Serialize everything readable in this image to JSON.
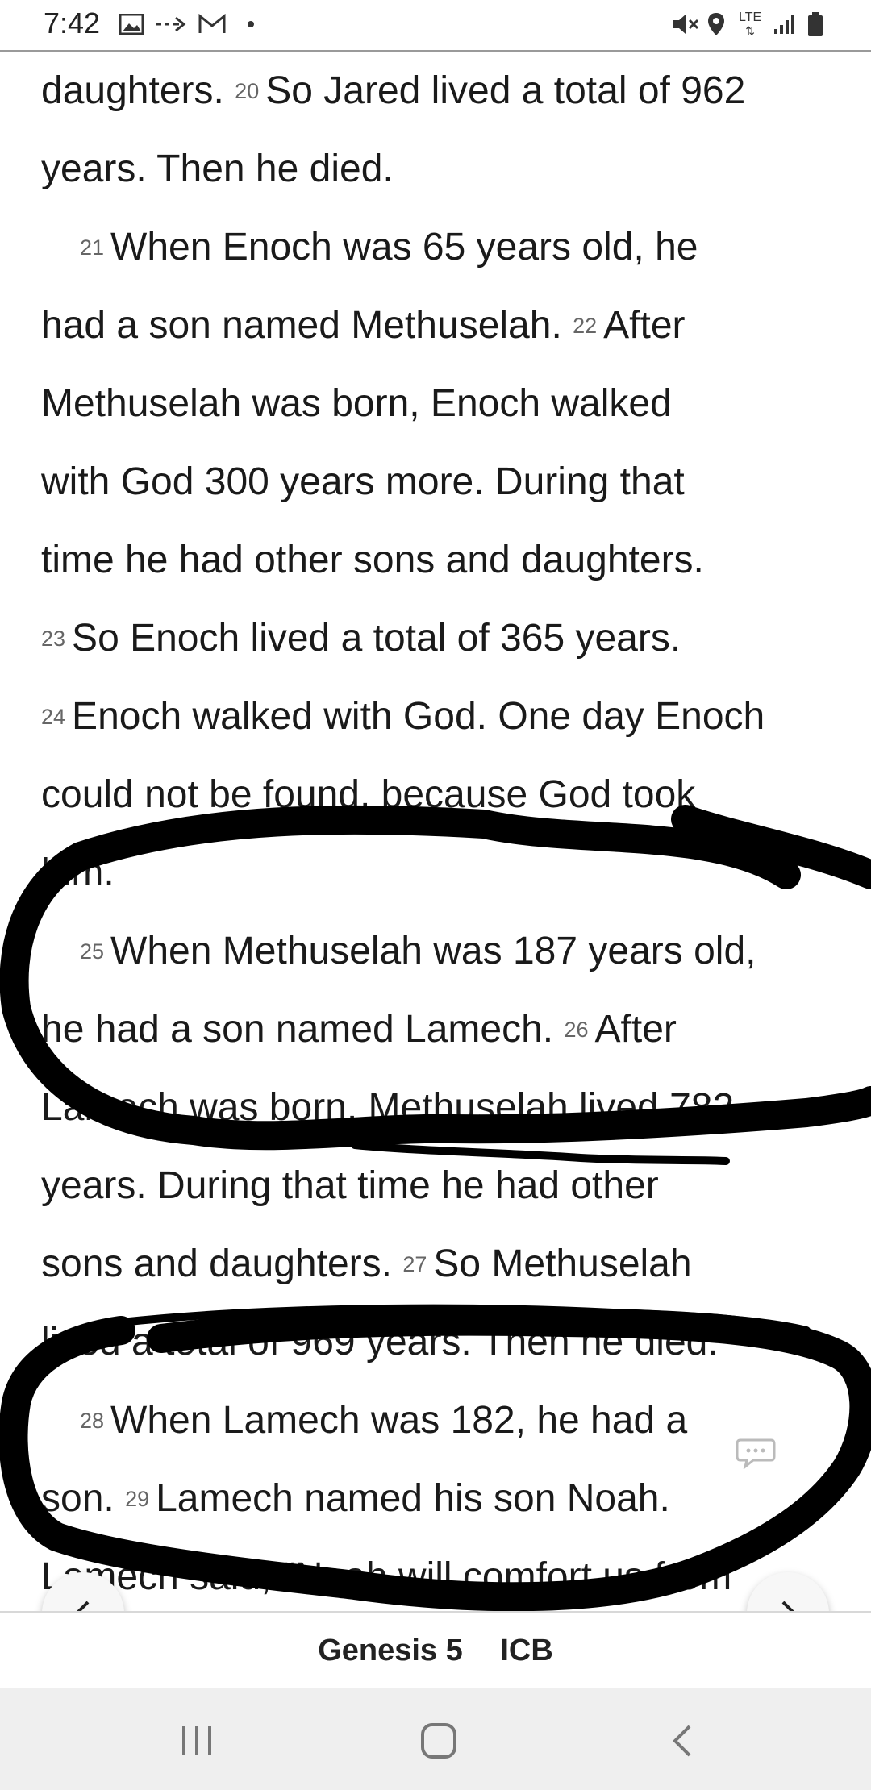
{
  "status_bar": {
    "time": "7:42",
    "left_icons": [
      "image-icon",
      "forward-arrow-icon",
      "gmail-icon",
      "dot-icon"
    ],
    "right_icons": [
      "mute-icon",
      "location-icon",
      "lte-icon",
      "signal-icon",
      "battery-icon"
    ],
    "lte_label": "LTE"
  },
  "reader": {
    "lines": [
      {
        "segments": [
          {
            "t": "text",
            "v": "daughters. "
          },
          {
            "t": "num",
            "v": "20"
          },
          {
            "t": "text",
            "v": "So Jared lived a total of 962"
          }
        ]
      },
      {
        "segments": [
          {
            "t": "text",
            "v": "years. Then he died."
          }
        ]
      },
      {
        "indent": true,
        "segments": [
          {
            "t": "num",
            "v": "21"
          },
          {
            "t": "text",
            "v": "When Enoch was 65 years old, he"
          }
        ]
      },
      {
        "segments": [
          {
            "t": "text",
            "v": "had a son named Methuselah. "
          },
          {
            "t": "num",
            "v": "22"
          },
          {
            "t": "text",
            "v": "After"
          }
        ]
      },
      {
        "segments": [
          {
            "t": "text",
            "v": "Methuselah was born, Enoch walked"
          }
        ]
      },
      {
        "segments": [
          {
            "t": "text",
            "v": "with God 300 years more. During that"
          }
        ]
      },
      {
        "segments": [
          {
            "t": "text",
            "v": "time he had other sons and daughters."
          }
        ]
      },
      {
        "segments": [
          {
            "t": "num",
            "v": "23"
          },
          {
            "t": "text",
            "v": "So Enoch lived a total of 365 years."
          }
        ]
      },
      {
        "segments": [
          {
            "t": "num",
            "v": "24"
          },
          {
            "t": "text",
            "v": "Enoch walked with God. One day Enoch"
          }
        ]
      },
      {
        "segments": [
          {
            "t": "text",
            "v": "could not be found, because God took"
          }
        ]
      },
      {
        "segments": [
          {
            "t": "text",
            "v": "him."
          }
        ]
      },
      {
        "indent": true,
        "segments": [
          {
            "t": "num",
            "v": "25"
          },
          {
            "t": "text",
            "v": "When Methuselah was 187 years old,"
          }
        ]
      },
      {
        "segments": [
          {
            "t": "text",
            "v": "he had a son named Lamech. "
          },
          {
            "t": "num",
            "v": "26"
          },
          {
            "t": "text",
            "v": "After"
          }
        ]
      },
      {
        "segments": [
          {
            "t": "text",
            "v": "Lamech was born, Methuselah lived 782"
          }
        ]
      },
      {
        "segments": [
          {
            "t": "text",
            "v": "years. During that time he had other"
          }
        ]
      },
      {
        "segments": [
          {
            "t": "text",
            "v": "sons and daughters. "
          },
          {
            "t": "num",
            "v": "27"
          },
          {
            "t": "text",
            "v": "So Methuselah"
          }
        ]
      },
      {
        "segments": [
          {
            "t": "text",
            "v": "lived a total of 969 years. Then he died."
          }
        ]
      },
      {
        "indent": true,
        "segments": [
          {
            "t": "num",
            "v": "28"
          },
          {
            "t": "text",
            "v": "When Lamech was 182, he had a"
          }
        ]
      },
      {
        "segments": [
          {
            "t": "text",
            "v": "son. "
          },
          {
            "t": "num",
            "v": "29"
          },
          {
            "t": "text",
            "v": "Lamech named his son Noah."
          }
        ]
      },
      {
        "segments": [
          {
            "t": "text",
            "v": "Lamech said, “Noah will comfort us from"
          }
        ]
      }
    ],
    "annotation_color": "#000000"
  },
  "navigation": {
    "prev_icon": "chevron-left-icon",
    "next_icon": "chevron-right-icon",
    "book_chapter": "Genesis 5",
    "version": "ICB"
  },
  "system_nav": {
    "buttons": [
      "recent-apps-icon",
      "home-icon",
      "back-icon"
    ]
  },
  "colors": {
    "text": "#1a1a1a",
    "verse_number": "#666666",
    "system_nav_bg": "#efefef"
  }
}
